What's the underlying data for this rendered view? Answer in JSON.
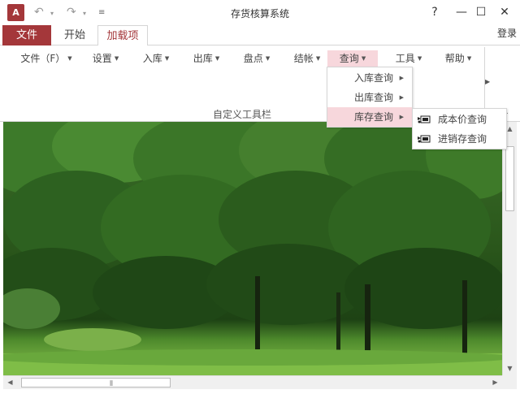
{
  "app": {
    "logo_text": "A",
    "title": "存货核算系统"
  },
  "window": {
    "help": "?",
    "minimize": "—",
    "maximize": "☐",
    "close": "✕"
  },
  "tabs": {
    "file": "文件",
    "home": "开始",
    "addins": "加载项",
    "login": "登录"
  },
  "ribbon": {
    "menu": [
      {
        "label": "文件（F）"
      },
      {
        "label": "设置"
      },
      {
        "label": "入库"
      },
      {
        "label": "出库"
      },
      {
        "label": "盘点"
      },
      {
        "label": "结帐"
      },
      {
        "label": "查询"
      },
      {
        "label": "工具"
      },
      {
        "label": "帮助"
      }
    ],
    "group_label": "自定义工具栏"
  },
  "dropdown": {
    "items": [
      {
        "label": "入库查询"
      },
      {
        "label": "出库查询"
      },
      {
        "label": "库存查询"
      }
    ]
  },
  "submenu": {
    "items": [
      {
        "label": "成本价查询"
      },
      {
        "label": "进销存查询"
      }
    ]
  },
  "scrollbar": {
    "grip": "⦀"
  },
  "colors": {
    "accent": "#a4373a",
    "menu_highlight": "#f7d7dc"
  }
}
